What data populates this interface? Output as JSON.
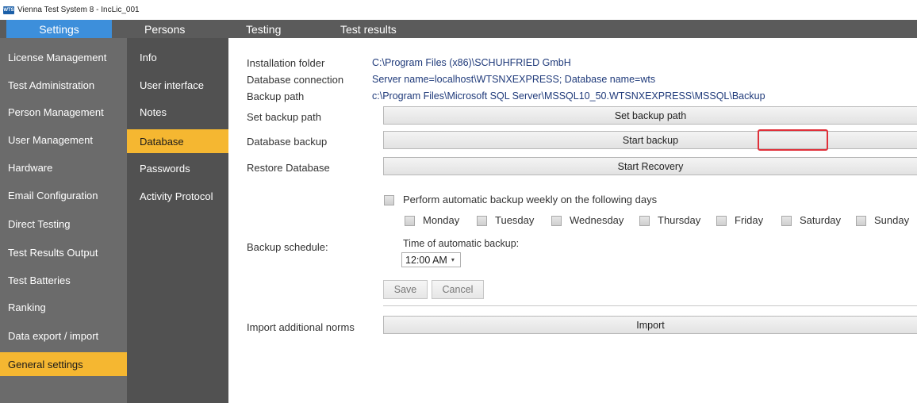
{
  "window": {
    "title": "Vienna Test System 8 - IncLic_001",
    "icon": "wts-app-icon",
    "icon_text": "WTS"
  },
  "top_tabs": [
    {
      "label": "Settings",
      "active": true
    },
    {
      "label": "Persons",
      "active": false
    },
    {
      "label": "Testing",
      "active": false
    },
    {
      "label": "Test results",
      "active": false
    }
  ],
  "sidebar": {
    "items": [
      {
        "label": "License Management"
      },
      {
        "label": "Test Administration"
      },
      {
        "label": "Person Management"
      },
      {
        "label": "User Management"
      },
      {
        "label": "Hardware"
      },
      {
        "label": "Email Configuration"
      },
      {
        "label": "Direct Testing"
      },
      {
        "label": "Test Results Output"
      },
      {
        "label": "Test Batteries"
      },
      {
        "label": "Ranking"
      },
      {
        "label": "Data export / import"
      },
      {
        "label": "General settings",
        "active": true
      }
    ]
  },
  "subnav": {
    "items": [
      {
        "label": "Info"
      },
      {
        "label": "User interface"
      },
      {
        "label": "Notes"
      },
      {
        "label": "Database",
        "active": true
      },
      {
        "label": "Passwords"
      },
      {
        "label": "Activity Protocol"
      }
    ]
  },
  "info": {
    "installation_folder_label": "Installation folder",
    "installation_folder_value": "C:\\Program Files (x86)\\SCHUHFRIED GmbH",
    "database_connection_label": "Database connection",
    "database_connection_value": "Server name=localhost\\WTSNXEXPRESS; Database name=wts",
    "backup_path_label": "Backup path",
    "backup_path_value": "c:\\Program Files\\Microsoft SQL Server\\MSSQL10_50.WTSNXEXPRESS\\MSSQL\\Backup"
  },
  "actions": {
    "set_backup_path_label": "Set backup path",
    "set_backup_path_button": "Set backup path",
    "database_backup_label": "Database backup",
    "start_backup_button": "Start backup",
    "restore_database_label": "Restore Database",
    "start_recovery_button": "Start Recovery"
  },
  "schedule": {
    "label": "Backup schedule:",
    "weekly_checkbox_label": "Perform automatic backup weekly on the following days",
    "days": [
      "Monday",
      "Tuesday",
      "Wednesday",
      "Thursday",
      "Friday",
      "Saturday",
      "Sunday"
    ],
    "time_label": "Time of automatic backup:",
    "time_value": "12:00 AM",
    "save_button": "Save",
    "cancel_button": "Cancel"
  },
  "import": {
    "label": "Import additional norms",
    "button": "Import"
  },
  "colors": {
    "active_tab": "#3d8fdb",
    "active_nav": "#f5b731",
    "highlight": "#e0303a",
    "sidebar_bg": "#6b6b6b",
    "subnav_bg": "#515151",
    "value_text": "#1f3a7a"
  }
}
